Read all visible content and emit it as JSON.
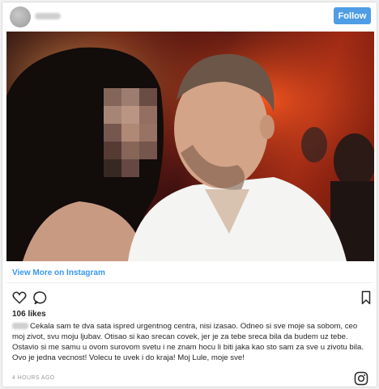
{
  "header": {
    "follow_label": "Follow"
  },
  "view_more": "View More on Instagram",
  "likes": "106 likes",
  "caption": "Cekala sam te dva sata ispred urgentnog centra, nisi izasao. Odneo si sve moje sa sobom, ceo moj zivot, svu moju ljubav. Otisao si kao srecan covek, jer je za tebe sreca bila da budem uz tebe. Ostavio si me samu u ovom surovom svetu i ne znam hocu li biti jaka kao sto sam za sve u zivotu bila. Ovo je jedna vecnost! Volecu te uvek i do kraja! Moj Lule, moje sve!",
  "timestamp": "4 HOURS AGO",
  "colors": {
    "accent": "#3897f0",
    "follow_button": "#4f9de4"
  },
  "icons": [
    "heart-icon",
    "comment-icon",
    "bookmark-icon",
    "instagram-logo-icon"
  ]
}
